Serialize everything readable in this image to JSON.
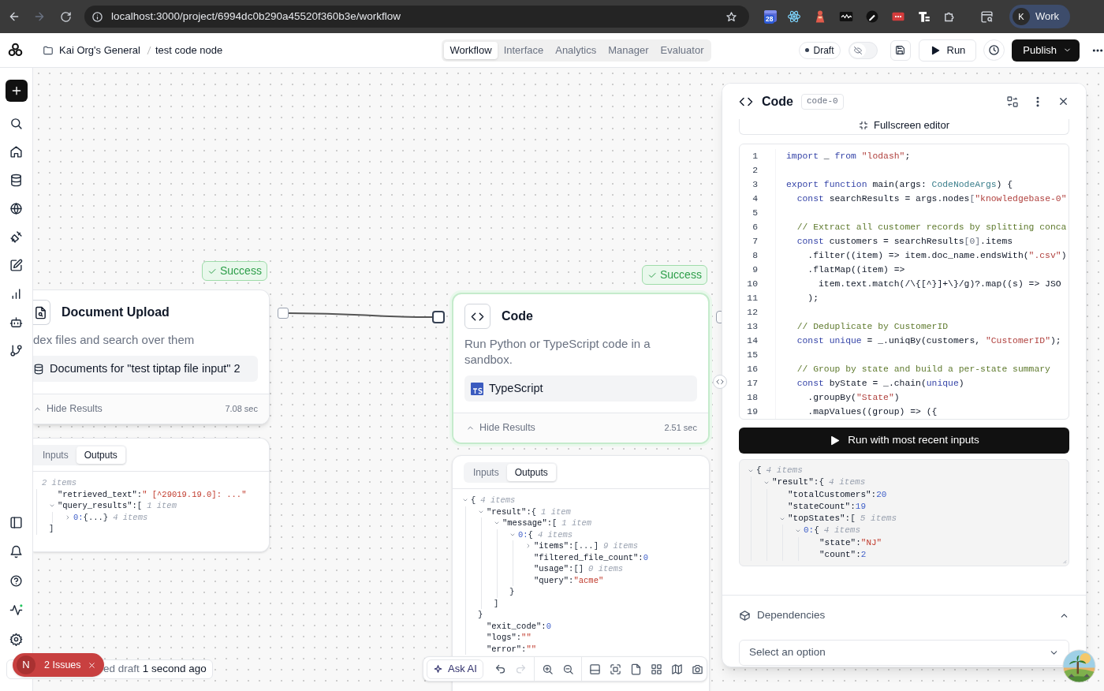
{
  "browser": {
    "url": "localhost:3000/project/6994dc0b290a45520f360b3e/workflow",
    "extension_badge": "28",
    "profile": {
      "initial": "K",
      "label": "Work"
    }
  },
  "header": {
    "breadcrumb": [
      "Kai Org's General",
      "test code node"
    ],
    "tabs": [
      {
        "label": "Workflow",
        "selected": true
      },
      {
        "label": "Interface",
        "selected": false
      },
      {
        "label": "Analytics",
        "selected": false
      },
      {
        "label": "Manager",
        "selected": false
      },
      {
        "label": "Evaluator",
        "selected": false
      }
    ],
    "status": "Draft",
    "visibility_toggle": {
      "on": false
    },
    "run_label": "Run",
    "publish_label": "Publish"
  },
  "nodes": [
    {
      "kind": "document_upload",
      "selected": false,
      "badge": "Success",
      "title": "Document Upload",
      "description": "dex files and search over them",
      "chip": "Documents for \"test tiptap file input\" 2",
      "results_label": "Hide Results",
      "duration": "7.08 sec",
      "io_tabs": [
        {
          "label": "Inputs",
          "selected": false
        },
        {
          "label": "Outputs",
          "selected": true
        }
      ],
      "output": {
        "note": "2 items",
        "children": [
          {
            "key": "\"retrieved_text\":",
            "value": "\" [^29019.19.0]: ...\"",
            "kind": "string"
          },
          {
            "key": "\"query_results\":",
            "bracket": "[",
            "note": "1 item",
            "expanded": true,
            "children": [
              {
                "key": "0:",
                "kind": "index",
                "bracket": "{...}",
                "note": "4 items",
                "expanded": false
              }
            ],
            "closing": "]"
          }
        ]
      }
    },
    {
      "kind": "code",
      "selected": true,
      "badge": "Success",
      "title": "Code",
      "description": "Run Python or TypeScript code in a sandbox.",
      "chip": "TypeScript",
      "results_label": "Hide Results",
      "duration": "2.51 sec",
      "io_tabs": [
        {
          "label": "Inputs",
          "selected": false
        },
        {
          "label": "Outputs",
          "selected": true
        }
      ],
      "output": {
        "bracket": "{",
        "note": "4 items",
        "expanded": true,
        "children": [
          {
            "key": "\"result\":",
            "bracket": "{",
            "note": "1 item",
            "expanded": true,
            "children": [
              {
                "key": "\"message\":",
                "bracket": "[",
                "note": "1 item",
                "expanded": true,
                "children": [
                  {
                    "key": "0:",
                    "kind": "index",
                    "bracket": "{",
                    "note": "4 items",
                    "expanded": true,
                    "children": [
                      {
                        "key": "\"items\":",
                        "bracket": "[...]",
                        "note": "9 items",
                        "expanded": false
                      },
                      {
                        "key": "\"filtered_file_count\":",
                        "value": "0",
                        "kind": "number"
                      },
                      {
                        "key": "\"usage\":",
                        "value": "[]",
                        "kind": "empty",
                        "note": "0 items"
                      },
                      {
                        "key": "\"query\":",
                        "value": "\"acme\"",
                        "kind": "string"
                      }
                    ],
                    "closing": "}"
                  }
                ],
                "closing": "]"
              }
            ],
            "closing": "}"
          },
          {
            "key": "\"exit_code\":",
            "value": "0",
            "kind": "number"
          },
          {
            "key": "\"logs\":",
            "value": "\"\"",
            "kind": "string"
          },
          {
            "key": "\"error\":",
            "value": "\"\"",
            "kind": "string"
          }
        ]
      }
    }
  ],
  "inspector": {
    "title": "Code",
    "id_badge": "code-0",
    "fullscreen_label": "Fullscreen editor",
    "code_lines": [
      {
        "number": "1",
        "tokens": [
          {
            "text": "import",
            "kind": "kw"
          },
          {
            "text": " _ ",
            "kind": "plain"
          },
          {
            "text": "from",
            "kind": "kw"
          },
          {
            "text": " \"lodash\"",
            "kind": "str"
          },
          {
            "text": ";",
            "kind": "plain"
          }
        ]
      },
      {
        "number": "2"
      },
      {
        "number": "3",
        "tokens": [
          {
            "text": "export function",
            "kind": "kw"
          },
          {
            "text": " main(args: ",
            "kind": "plain"
          },
          {
            "text": "CodeNodeArgs",
            "kind": "type"
          },
          {
            "text": ") {",
            "kind": "plain"
          }
        ]
      },
      {
        "number": "4",
        "tokens": [
          {
            "text": "  const",
            "kind": "kw"
          },
          {
            "text": " searchResults = args.nodes",
            "kind": "plain"
          },
          {
            "text": "[",
            "kind": "punct"
          },
          {
            "text": "\"knowledgebase-0\"",
            "kind": "str"
          }
        ]
      },
      {
        "number": "5"
      },
      {
        "number": "6",
        "tokens": [
          {
            "text": "  // Extract all customer records by splitting conca",
            "kind": "com"
          }
        ]
      },
      {
        "number": "7",
        "tokens": [
          {
            "text": "  const",
            "kind": "kw"
          },
          {
            "text": " customers = searchResults",
            "kind": "plain"
          },
          {
            "text": "[0]",
            "kind": "punct"
          },
          {
            "text": ".items",
            "kind": "plain"
          }
        ]
      },
      {
        "number": "8",
        "tokens": [
          {
            "text": "    .filter((item) => item.doc_name.endsWith(",
            "kind": "plain"
          },
          {
            "text": "\".csv\"",
            "kind": "str"
          },
          {
            "text": ")",
            "kind": "plain"
          }
        ]
      },
      {
        "number": "9",
        "tokens": [
          {
            "text": "    .flatMap((item) =>",
            "kind": "plain"
          }
        ]
      },
      {
        "number": "10",
        "tokens": [
          {
            "text": "      item.text.match(/\\{[^}]+\\}/g)?.map((s) => JSO",
            "kind": "plain"
          }
        ]
      },
      {
        "number": "11",
        "tokens": [
          {
            "text": "    );",
            "kind": "plain"
          }
        ]
      },
      {
        "number": "12"
      },
      {
        "number": "13",
        "tokens": [
          {
            "text": "  // Deduplicate by CustomerID",
            "kind": "com"
          }
        ]
      },
      {
        "number": "14",
        "tokens": [
          {
            "text": "  const",
            "kind": "kw"
          },
          {
            "text": " unique",
            "kind": "var"
          },
          {
            "text": " = _.uniqBy(customers, ",
            "kind": "plain"
          },
          {
            "text": "\"CustomerID\"",
            "kind": "str"
          },
          {
            "text": ");",
            "kind": "plain"
          }
        ]
      },
      {
        "number": "15"
      },
      {
        "number": "16",
        "tokens": [
          {
            "text": "  // Group by state and build a per-state summary",
            "kind": "com"
          }
        ]
      },
      {
        "number": "17",
        "tokens": [
          {
            "text": "  const",
            "kind": "kw"
          },
          {
            "text": " byState = _.chain(",
            "kind": "plain"
          },
          {
            "text": "unique",
            "kind": "var"
          },
          {
            "text": ")",
            "kind": "plain"
          }
        ]
      },
      {
        "number": "18",
        "tokens": [
          {
            "text": "    .groupBy(",
            "kind": "plain"
          },
          {
            "text": "\"State\"",
            "kind": "str"
          },
          {
            "text": ")",
            "kind": "plain"
          }
        ]
      },
      {
        "number": "19",
        "tokens": [
          {
            "text": "    .mapValues((group) => ({",
            "kind": "plain"
          }
        ]
      }
    ],
    "run_label": "Run with most recent inputs",
    "output": {
      "bracket": "{",
      "note": "4 items",
      "expanded": true,
      "children": [
        {
          "key": "\"result\":",
          "bracket": "{",
          "note": "4 items",
          "expanded": true,
          "children": [
            {
              "key": "\"totalCustomers\":",
              "value": "20",
              "kind": "number"
            },
            {
              "key": "\"stateCount\":",
              "value": "19",
              "kind": "number"
            },
            {
              "key": "\"topStates\":",
              "bracket": "[",
              "note": "5 items",
              "expanded": true,
              "children": [
                {
                  "key": "0:",
                  "kind": "index",
                  "bracket": "{",
                  "note": "4 items",
                  "expanded": true,
                  "children": [
                    {
                      "key": "\"state\":",
                      "value": "\"NJ\"",
                      "kind": "string"
                    },
                    {
                      "key": "\"count\":",
                      "value": "2",
                      "kind": "number"
                    }
                  ]
                }
              ]
            }
          ]
        }
      ]
    },
    "dependencies_label": "Dependencies",
    "select_placeholder": "Select an option"
  },
  "toolbar": {
    "ask_ai": "Ask AI",
    "tools": [
      {
        "kind": "undo",
        "disabled": false
      },
      {
        "kind": "redo",
        "disabled": true
      },
      {
        "kind": "zoom_in",
        "disabled": false
      },
      {
        "kind": "zoom_out",
        "disabled": false
      },
      {
        "kind": "layout",
        "disabled": false
      },
      {
        "kind": "fit",
        "disabled": false
      },
      {
        "kind": "page",
        "disabled": false
      },
      {
        "kind": "grid",
        "disabled": false
      },
      {
        "kind": "map",
        "disabled": false
      },
      {
        "kind": "camera",
        "disabled": false
      }
    ]
  },
  "issues": {
    "initial": "N",
    "label": "2 Issues"
  },
  "save_status": {
    "text": "ed draft",
    "time": "1 second ago"
  }
}
